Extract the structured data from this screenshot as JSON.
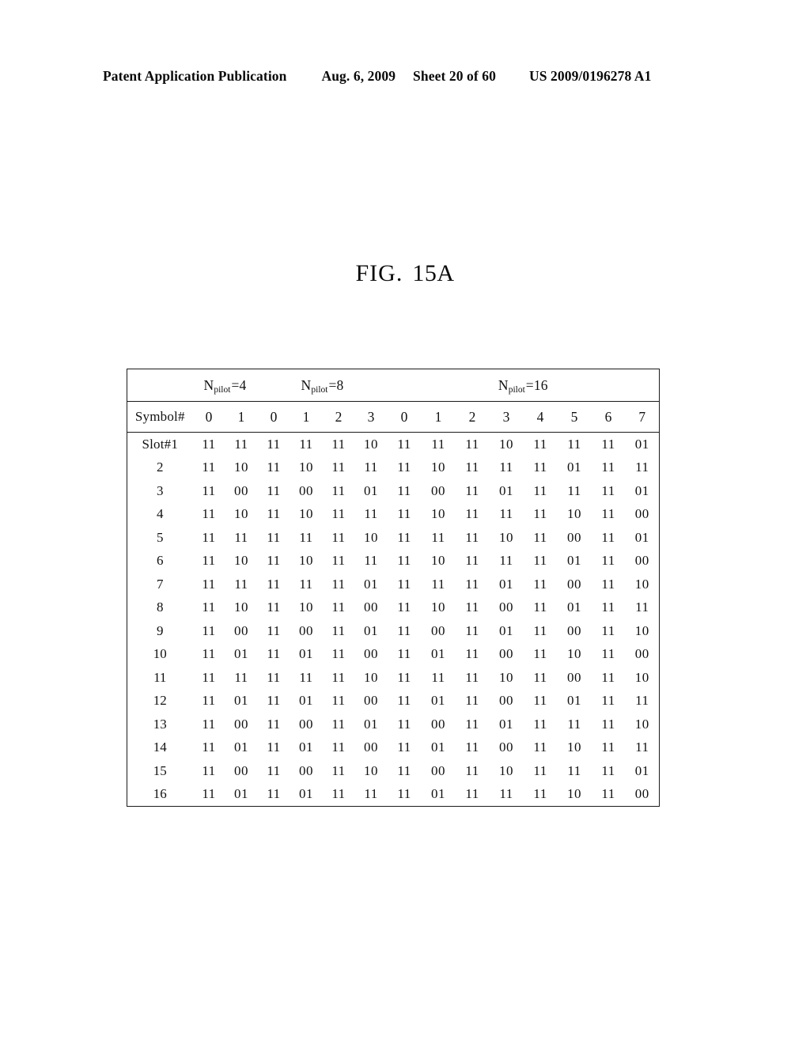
{
  "header": {
    "publication": "Patent Application Publication",
    "date": "Aug. 6, 2009",
    "sheet": "Sheet 20 of 60",
    "patent_number": "US 2009/0196278 A1"
  },
  "figure": {
    "label": "FIG.",
    "number": "15A"
  },
  "table": {
    "corner_label": "",
    "symbol_row_label": "Symbol#",
    "row_label_first": "Slot#1",
    "groups": [
      {
        "prefix": "N",
        "subscript": "pilot",
        "suffix": "=4",
        "symbols": [
          "0",
          "1"
        ]
      },
      {
        "prefix": "N",
        "subscript": "pilot",
        "suffix": "=8",
        "symbols": [
          "0",
          "1",
          "2",
          "3"
        ]
      },
      {
        "prefix": "N",
        "subscript": "pilot",
        "suffix": "=16",
        "symbols": [
          "0",
          "1",
          "2",
          "3",
          "4",
          "5",
          "6",
          "7"
        ]
      }
    ],
    "row_labels": [
      "Slot#1",
      "2",
      "3",
      "4",
      "5",
      "6",
      "7",
      "8",
      "9",
      "10",
      "11",
      "12",
      "13",
      "14",
      "15",
      "16"
    ],
    "rows": [
      {
        "label": "Slot#1",
        "n4": [
          "11",
          "11"
        ],
        "n8": [
          "11",
          "11",
          "11",
          "10"
        ],
        "n16": [
          "11",
          "11",
          "11",
          "10",
          "11",
          "11",
          "11",
          "01"
        ]
      },
      {
        "label": "2",
        "n4": [
          "11",
          "10"
        ],
        "n8": [
          "11",
          "10",
          "11",
          "11"
        ],
        "n16": [
          "11",
          "10",
          "11",
          "11",
          "11",
          "01",
          "11",
          "11"
        ]
      },
      {
        "label": "3",
        "n4": [
          "11",
          "00"
        ],
        "n8": [
          "11",
          "00",
          "11",
          "01"
        ],
        "n16": [
          "11",
          "00",
          "11",
          "01",
          "11",
          "11",
          "11",
          "01"
        ]
      },
      {
        "label": "4",
        "n4": [
          "11",
          "10"
        ],
        "n8": [
          "11",
          "10",
          "11",
          "11"
        ],
        "n16": [
          "11",
          "10",
          "11",
          "11",
          "11",
          "10",
          "11",
          "00"
        ]
      },
      {
        "label": "5",
        "n4": [
          "11",
          "11"
        ],
        "n8": [
          "11",
          "11",
          "11",
          "10"
        ],
        "n16": [
          "11",
          "11",
          "11",
          "10",
          "11",
          "00",
          "11",
          "01"
        ]
      },
      {
        "label": "6",
        "n4": [
          "11",
          "10"
        ],
        "n8": [
          "11",
          "10",
          "11",
          "11"
        ],
        "n16": [
          "11",
          "10",
          "11",
          "11",
          "11",
          "01",
          "11",
          "00"
        ]
      },
      {
        "label": "7",
        "n4": [
          "11",
          "11"
        ],
        "n8": [
          "11",
          "11",
          "11",
          "01"
        ],
        "n16": [
          "11",
          "11",
          "11",
          "01",
          "11",
          "00",
          "11",
          "10"
        ]
      },
      {
        "label": "8",
        "n4": [
          "11",
          "10"
        ],
        "n8": [
          "11",
          "10",
          "11",
          "00"
        ],
        "n16": [
          "11",
          "10",
          "11",
          "00",
          "11",
          "01",
          "11",
          "11"
        ]
      },
      {
        "label": "9",
        "n4": [
          "11",
          "00"
        ],
        "n8": [
          "11",
          "00",
          "11",
          "01"
        ],
        "n16": [
          "11",
          "00",
          "11",
          "01",
          "11",
          "00",
          "11",
          "10"
        ]
      },
      {
        "label": "10",
        "n4": [
          "11",
          "01"
        ],
        "n8": [
          "11",
          "01",
          "11",
          "00"
        ],
        "n16": [
          "11",
          "01",
          "11",
          "00",
          "11",
          "10",
          "11",
          "00"
        ]
      },
      {
        "label": "11",
        "n4": [
          "11",
          "11"
        ],
        "n8": [
          "11",
          "11",
          "11",
          "10"
        ],
        "n16": [
          "11",
          "11",
          "11",
          "10",
          "11",
          "00",
          "11",
          "10"
        ]
      },
      {
        "label": "12",
        "n4": [
          "11",
          "01"
        ],
        "n8": [
          "11",
          "01",
          "11",
          "00"
        ],
        "n16": [
          "11",
          "01",
          "11",
          "00",
          "11",
          "01",
          "11",
          "11"
        ]
      },
      {
        "label": "13",
        "n4": [
          "11",
          "00"
        ],
        "n8": [
          "11",
          "00",
          "11",
          "01"
        ],
        "n16": [
          "11",
          "00",
          "11",
          "01",
          "11",
          "11",
          "11",
          "10"
        ]
      },
      {
        "label": "14",
        "n4": [
          "11",
          "01"
        ],
        "n8": [
          "11",
          "01",
          "11",
          "00"
        ],
        "n16": [
          "11",
          "01",
          "11",
          "00",
          "11",
          "10",
          "11",
          "11"
        ]
      },
      {
        "label": "15",
        "n4": [
          "11",
          "00"
        ],
        "n8": [
          "11",
          "00",
          "11",
          "10"
        ],
        "n16": [
          "11",
          "00",
          "11",
          "10",
          "11",
          "11",
          "11",
          "01"
        ]
      },
      {
        "label": "16",
        "n4": [
          "11",
          "01"
        ],
        "n8": [
          "11",
          "01",
          "11",
          "11"
        ],
        "n16": [
          "11",
          "01",
          "11",
          "11",
          "11",
          "10",
          "11",
          "00"
        ]
      }
    ]
  }
}
